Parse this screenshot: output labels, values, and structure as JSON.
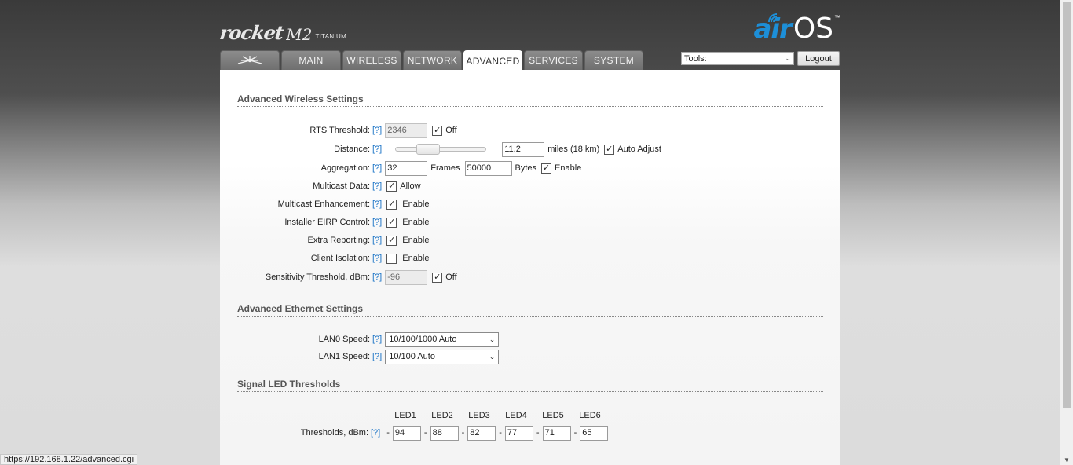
{
  "header": {
    "model": "rocket",
    "model_suffix": "M2",
    "model_sub": "TITANIUM",
    "os_brand_prefix": "air",
    "os_brand_suffix": "OS",
    "os_brand_tm": "™"
  },
  "tabs": [
    {
      "label": "",
      "icon": "ubiquiti-logo-icon"
    },
    {
      "label": "MAIN"
    },
    {
      "label": "WIRELESS"
    },
    {
      "label": "NETWORK"
    },
    {
      "label": "ADVANCED",
      "active": true
    },
    {
      "label": "SERVICES"
    },
    {
      "label": "SYSTEM"
    }
  ],
  "toolbar": {
    "tools_value": "Tools:",
    "logout_label": "Logout"
  },
  "help_text": "[?]",
  "wireless": {
    "title": "Advanced Wireless Settings",
    "rts": {
      "label": "RTS Threshold:",
      "value": "2346",
      "off_label": "Off",
      "off_checked": true
    },
    "distance": {
      "label": "Distance:",
      "value": "11.2",
      "unit": "miles (18 km)",
      "auto_label": "Auto Adjust",
      "auto_checked": true,
      "slider_position": 0.33
    },
    "aggregation": {
      "label": "Aggregation:",
      "frames": "32",
      "frames_label": "Frames",
      "bytes": "50000",
      "bytes_label": "Bytes",
      "enable_label": "Enable",
      "enable_checked": true
    },
    "multicast_data": {
      "label": "Multicast Data:",
      "option": "Allow",
      "checked": true
    },
    "multicast_enh": {
      "label": "Multicast Enhancement:",
      "option": "Enable",
      "checked": true
    },
    "eirp": {
      "label": "Installer EIRP Control:",
      "option": "Enable",
      "checked": true
    },
    "extra_reporting": {
      "label": "Extra Reporting:",
      "option": "Enable",
      "checked": true
    },
    "client_isolation": {
      "label": "Client Isolation:",
      "option": "Enable",
      "checked": false
    },
    "sensitivity": {
      "label": "Sensitivity Threshold, dBm:",
      "value": "-96",
      "off_label": "Off",
      "off_checked": true
    }
  },
  "ethernet": {
    "title": "Advanced Ethernet Settings",
    "lan0": {
      "label": "LAN0 Speed:",
      "value": "10/100/1000 Auto"
    },
    "lan1": {
      "label": "LAN1 Speed:",
      "value": "10/100 Auto"
    }
  },
  "led": {
    "title": "Signal LED Thresholds",
    "label": "Thresholds, dBm:",
    "headers": [
      "LED1",
      "LED2",
      "LED3",
      "LED4",
      "LED5",
      "LED6"
    ],
    "values": [
      "94",
      "88",
      "82",
      "77",
      "71",
      "65"
    ],
    "dash": "-"
  },
  "status_bar": {
    "url": "https://192.168.1.22/advanced.cgi"
  },
  "colors": {
    "accent": "#1d8fd8",
    "help_link": "#1a73c6"
  }
}
